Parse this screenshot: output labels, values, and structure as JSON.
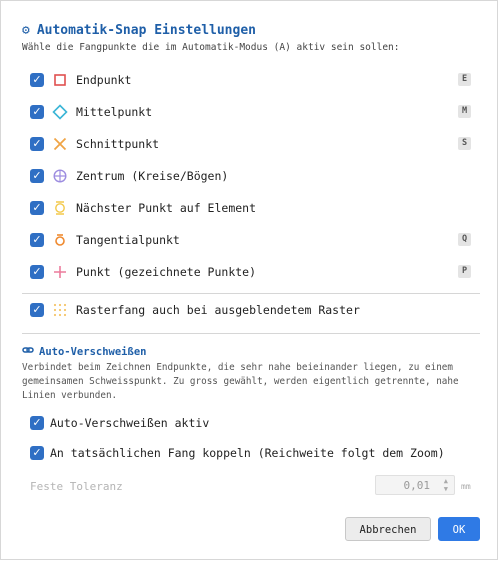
{
  "dialog": {
    "title": "Automatik-Snap Einstellungen",
    "subtitle": "Wähle die Fangpunkte die im Automatik-Modus (A) aktiv sein sollen:",
    "snap_options": [
      {
        "label": "Endpunkt",
        "checked": true,
        "icon": "square-icon",
        "shortcut": "E"
      },
      {
        "label": "Mittelpunkt",
        "checked": true,
        "icon": "diamond-icon",
        "shortcut": "M"
      },
      {
        "label": "Schnittpunkt",
        "checked": true,
        "icon": "cross-x-icon",
        "shortcut": "S"
      },
      {
        "label": "Zentrum (Kreise/Bögen)",
        "checked": true,
        "icon": "circle-crosshair-icon",
        "shortcut": ""
      },
      {
        "label": "Nächster Punkt auf Element",
        "checked": true,
        "icon": "hourglass-icon",
        "shortcut": ""
      },
      {
        "label": "Tangentialpunkt",
        "checked": true,
        "icon": "tangent-icon",
        "shortcut": "Q"
      },
      {
        "label": "Punkt (gezeichnete Punkte)",
        "checked": true,
        "icon": "plus-icon",
        "shortcut": "P"
      }
    ],
    "grid_option": {
      "label": "Rasterfang auch bei ausgeblendetem Raster",
      "checked": true,
      "icon": "grid-dots-icon"
    },
    "weld_section": {
      "title": "Auto-Verschweißen",
      "icon": "link-icon",
      "description": "Verbindet beim Zeichnen Endpunkte, die sehr nahe beieinander liegen, zu einem gemeinsamen Schweisspunkt. Zu gross gewählt, werden eigentlich getrennte, nahe Linien verbunden.",
      "auto_weld_label": "Auto-Verschweißen aktiv",
      "auto_weld_checked": true,
      "couple_label": "An tatsächlichen Fang koppeln (Reichweite folgt dem Zoom)",
      "couple_checked": true,
      "tolerance_label": "Feste Toleranz",
      "tolerance_value": "0,01",
      "tolerance_unit": "mm"
    },
    "buttons": {
      "cancel": "Abbrechen",
      "ok": "OK"
    },
    "colors": {
      "accent": "#1f5fa8",
      "checkbox": "#2f6fc4",
      "ok_button": "#2f7ae5",
      "endpoint": "#e0504f",
      "midpoint": "#3ab5d6",
      "intersection": "#f0a445",
      "center": "#9d8de0",
      "nearest": "#f3c94a",
      "tangent": "#ef8a30",
      "point": "#ec7c9c",
      "grid": "#f5c56a"
    }
  }
}
